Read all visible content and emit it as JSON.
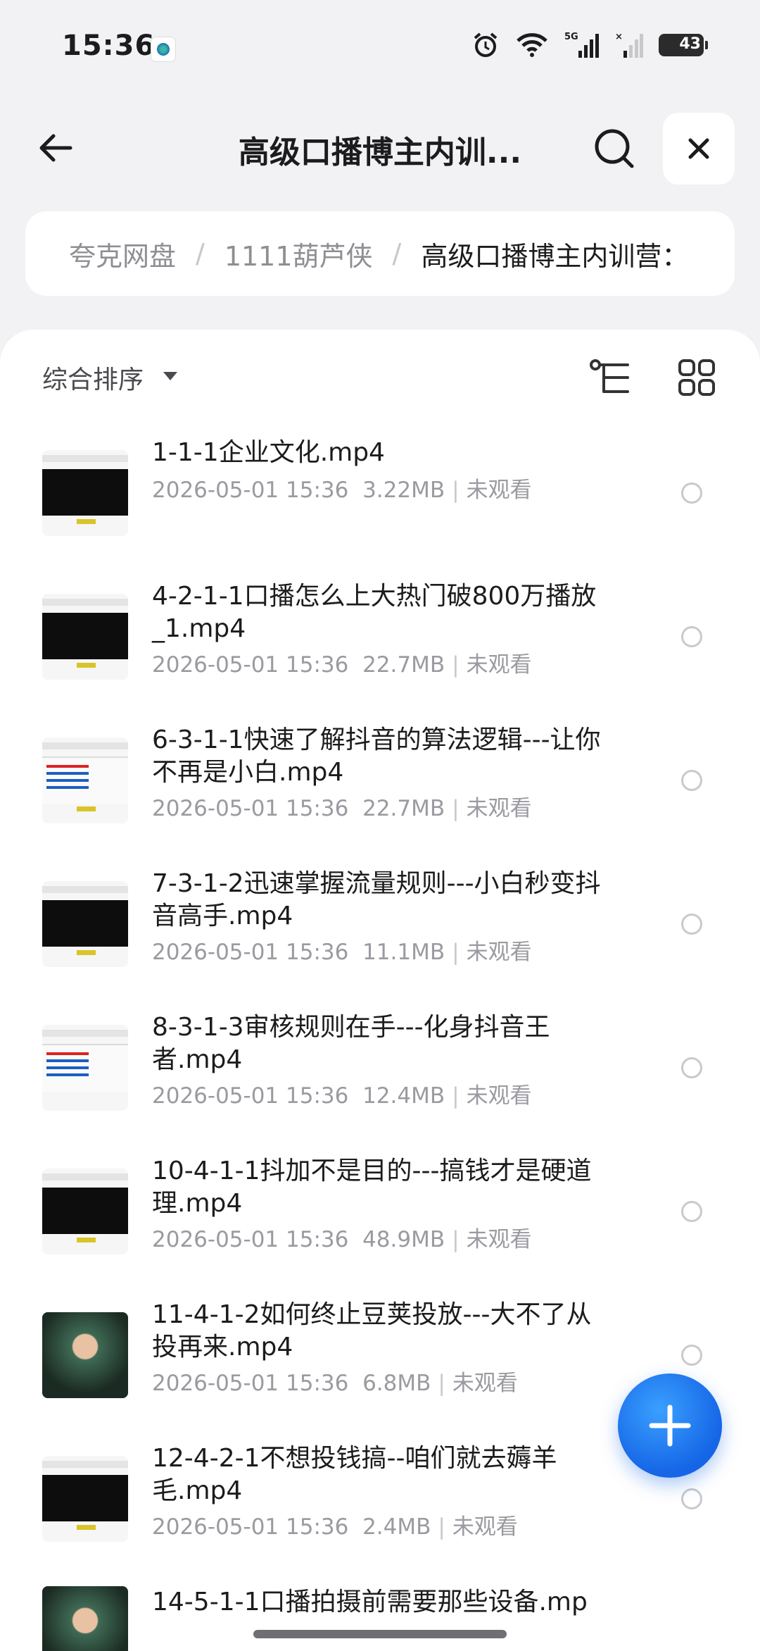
{
  "status_bar": {
    "time": "15:36",
    "battery": "43",
    "network": "5G"
  },
  "header": {
    "title": "高级口播博主内训..."
  },
  "breadcrumb": {
    "items": [
      "夸克网盘",
      "1111葫芦侠",
      "高级口播博主内训营："
    ],
    "separator": "/"
  },
  "toolbar": {
    "sort_label": "综合排序"
  },
  "files": [
    {
      "name": "1-1-1企业文化.mp4",
      "date": "2026-05-01 15:36",
      "size": "3.22MB",
      "status": "未观看"
    },
    {
      "name": "4-2-1-1口播怎么上大热门破800万播放_1.mp4",
      "date": "2026-05-01 15:36",
      "size": "22.7MB",
      "status": "未观看"
    },
    {
      "name": "6-3-1-1快速了解抖音的算法逻辑---让你不再是小白.mp4",
      "date": "2026-05-01 15:36",
      "size": "22.7MB",
      "status": "未观看"
    },
    {
      "name": "7-3-1-2迅速掌握流量规则---小白秒变抖音高手.mp4",
      "date": "2026-05-01 15:36",
      "size": "11.1MB",
      "status": "未观看"
    },
    {
      "name": "8-3-1-3审核规则在手---化身抖音王者.mp4",
      "date": "2026-05-01 15:36",
      "size": "12.4MB",
      "status": "未观看"
    },
    {
      "name": "10-4-1-1抖加不是目的---搞钱才是硬道理.mp4",
      "date": "2026-05-01 15:36",
      "size": "48.9MB",
      "status": "未观看"
    },
    {
      "name": "11-4-1-2如何终止豆荚投放---大不了从投再来.mp4",
      "date": "2026-05-01 15:36",
      "size": "6.8MB",
      "status": "未观看"
    },
    {
      "name": "12-4-2-1不想投钱搞--咱们就去薅羊毛.mp4",
      "date": "2026-05-01 15:36",
      "size": "2.4MB",
      "status": "未观看"
    },
    {
      "name": "14-5-1-1口播拍摄前需要那些设备.mp",
      "date": "",
      "size": "",
      "status": ""
    }
  ],
  "icons": {
    "back": "arrow-left-icon",
    "search": "search-icon",
    "close": "close-icon",
    "sort": "caret-down-icon",
    "tree": "tree-view-icon",
    "grid": "grid-view-icon",
    "add": "plus-icon"
  },
  "colors": {
    "accent": "#1565e6",
    "background": "#f2f2f4"
  }
}
